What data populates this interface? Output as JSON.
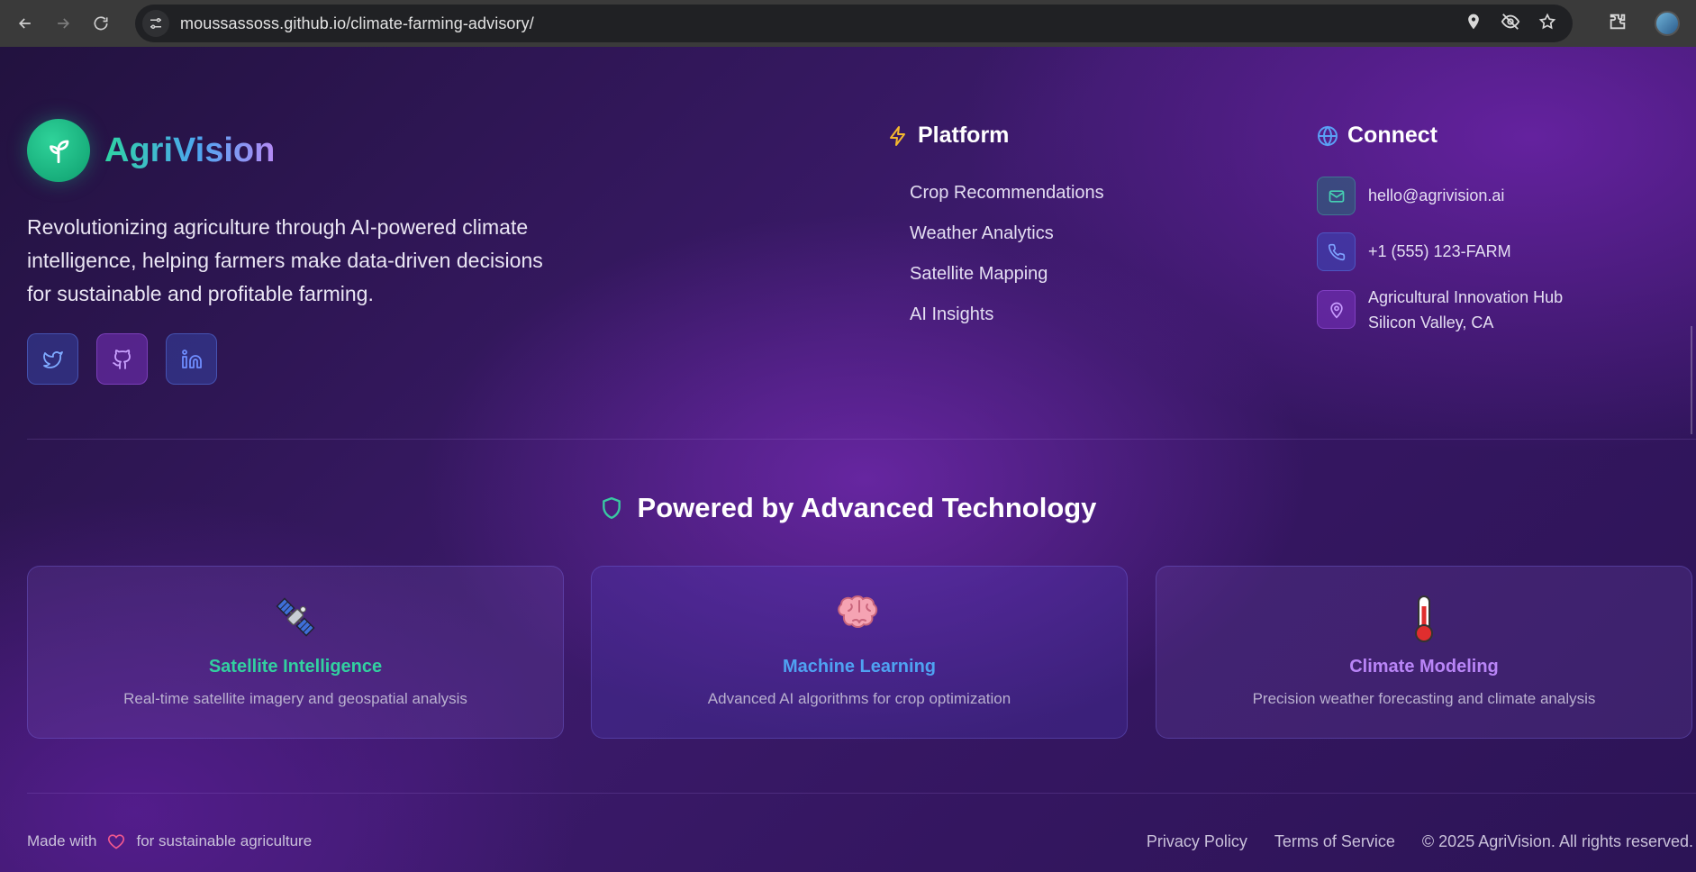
{
  "browser": {
    "url": "moussassoss.github.io/climate-farming-advisory/"
  },
  "brand": {
    "name": "AgriVision",
    "tagline": "Revolutionizing agriculture through AI-powered climate intelligence, helping farmers make data-driven decisions for sustainable and profitable farming."
  },
  "platform": {
    "title": "Platform",
    "links": [
      "Crop Recommendations",
      "Weather Analytics",
      "Satellite Mapping",
      "AI Insights"
    ]
  },
  "connect": {
    "title": "Connect",
    "email": "hello@agrivision.ai",
    "phone": "+1 (555) 123-FARM",
    "address_line1": "Agricultural Innovation Hub",
    "address_line2": "Silicon Valley, CA"
  },
  "tech": {
    "title": "Powered by Advanced Technology",
    "cards": [
      {
        "title": "Satellite Intelligence",
        "desc": "Real-time satellite imagery and geospatial analysis",
        "icon": "satellite-icon"
      },
      {
        "title": "Machine Learning",
        "desc": "Advanced AI algorithms for crop optimization",
        "icon": "brain-icon"
      },
      {
        "title": "Climate Modeling",
        "desc": "Precision weather forecasting and climate analysis",
        "icon": "thermometer-icon"
      }
    ]
  },
  "footer": {
    "made_with": "Made with",
    "for_text": "for sustainable agriculture",
    "privacy": "Privacy Policy",
    "terms": "Terms of Service",
    "copyright": "© 2025 AgriVision. All rights reserved."
  },
  "colors": {
    "accent_green": "#2ed3a3",
    "accent_blue": "#4ea6f0",
    "accent_purple": "#b58af5",
    "heart": "#f0578e"
  }
}
